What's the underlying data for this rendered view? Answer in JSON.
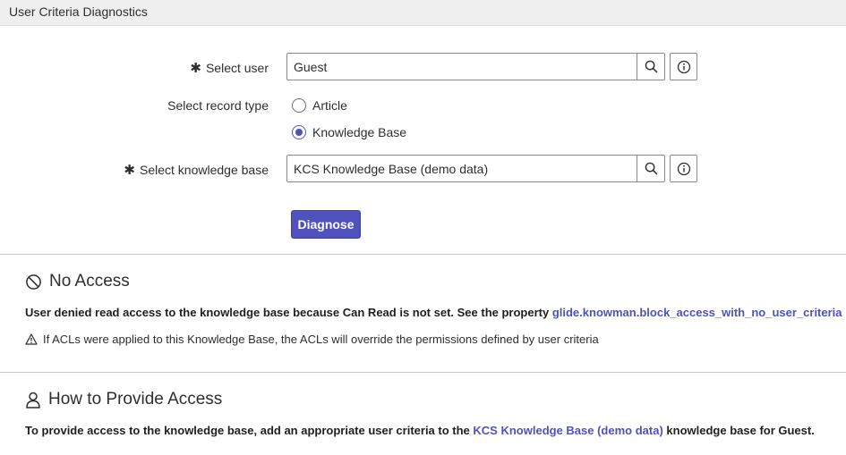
{
  "header": {
    "title": "User Criteria Diagnostics"
  },
  "form": {
    "user_label": "Select user",
    "user_value": "Guest",
    "record_type_label": "Select record type",
    "record_types": [
      {
        "label": "Article",
        "checked": false
      },
      {
        "label": "Knowledge Base",
        "checked": true
      }
    ],
    "kb_label": "Select knowledge base",
    "kb_value": "KCS Knowledge Base (demo data)",
    "diagnose_label": "Diagnose",
    "required_mark": "✱"
  },
  "no_access": {
    "title": "No Access",
    "message": "User denied read access to the knowledge base because Can Read is not set. See the property",
    "property_link": "glide.knowman.block_access_with_no_user_criteria",
    "note": "If ACLs were applied to this Knowledge Base, the ACLs will override the permissions defined by user criteria"
  },
  "provide_access": {
    "title": "How to Provide Access",
    "message_before": "To provide access to the knowledge base, add an appropriate user criteria to the",
    "kb_link": "KCS Knowledge Base (demo data)",
    "message_after": "knowledge base for Guest."
  },
  "icons": {
    "search": "search-icon",
    "info": "info-icon",
    "no_access": "prohibited-icon",
    "warning": "warning-icon",
    "user": "user-icon"
  },
  "colors": {
    "accent": "#4f52bd"
  }
}
